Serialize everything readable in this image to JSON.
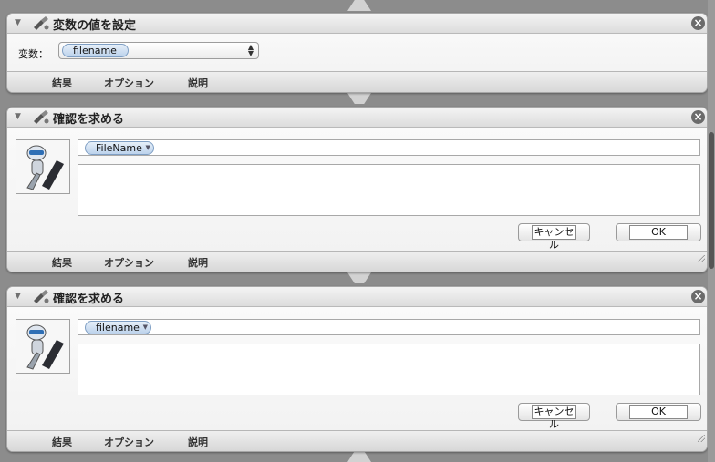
{
  "actions": [
    {
      "title": "変数の値を設定",
      "variable_label": "変数：",
      "variable_token": "filename",
      "footer": [
        "結果",
        "オプション",
        "説明"
      ]
    },
    {
      "title": "確認を求める",
      "message_token": "FileName",
      "cancel_label": "キャンセル",
      "ok_label": "OK",
      "footer": [
        "結果",
        "オプション",
        "説明"
      ]
    },
    {
      "title": "確認を求める",
      "message_token": "filename",
      "cancel_label": "キャンセル",
      "ok_label": "OK",
      "footer": [
        "結果",
        "オプション",
        "説明"
      ]
    }
  ],
  "icons": {
    "disclosure": "disclosure-triangle-icon",
    "action": "automator-action-icon",
    "close": "close-icon",
    "app": "automator-robot-icon"
  },
  "colors": {
    "token_fill": "#bcd2ec",
    "token_border": "#7f9fc4",
    "close_button": "#6b6b6b",
    "workflow_background": "#8c8c8c"
  }
}
